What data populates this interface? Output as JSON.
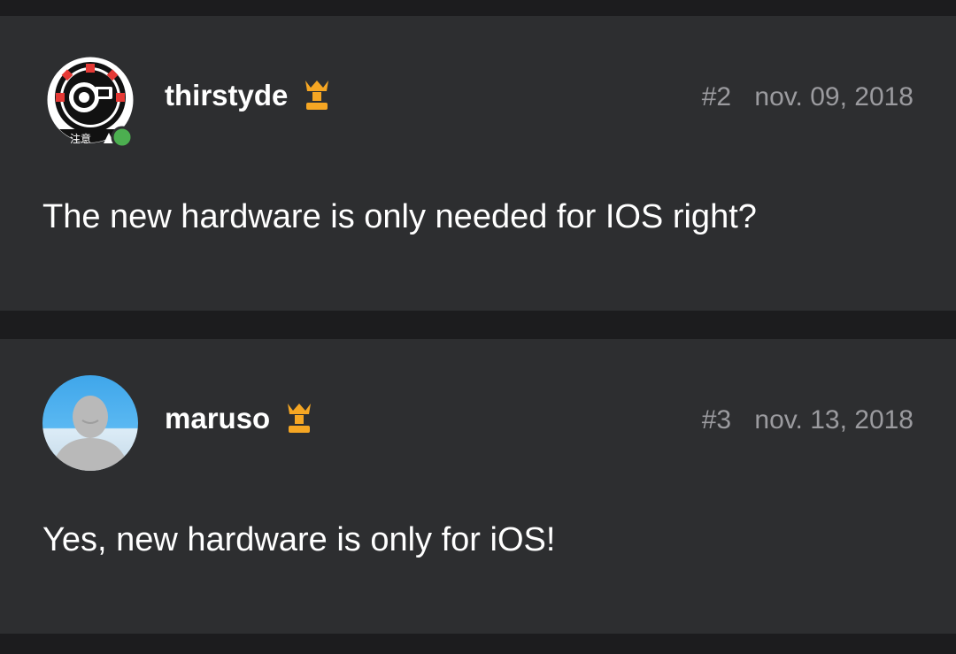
{
  "posts": [
    {
      "username": "thirstyde",
      "post_number": "#2",
      "date": "nov. 09, 2018",
      "body": "The new hardware is only needed for IOS right?",
      "avatar_text": "注意",
      "online": true
    },
    {
      "username": "maruso",
      "post_number": "#3",
      "date": "nov. 13, 2018",
      "body": "Yes, new hardware is only for iOS!",
      "online": false
    }
  ],
  "colors": {
    "background": "#1c1c1e",
    "card": "#2d2e30",
    "text": "#ffffff",
    "meta": "#9b9b9f",
    "badge": "#f5a623",
    "online": "#4caf50"
  }
}
